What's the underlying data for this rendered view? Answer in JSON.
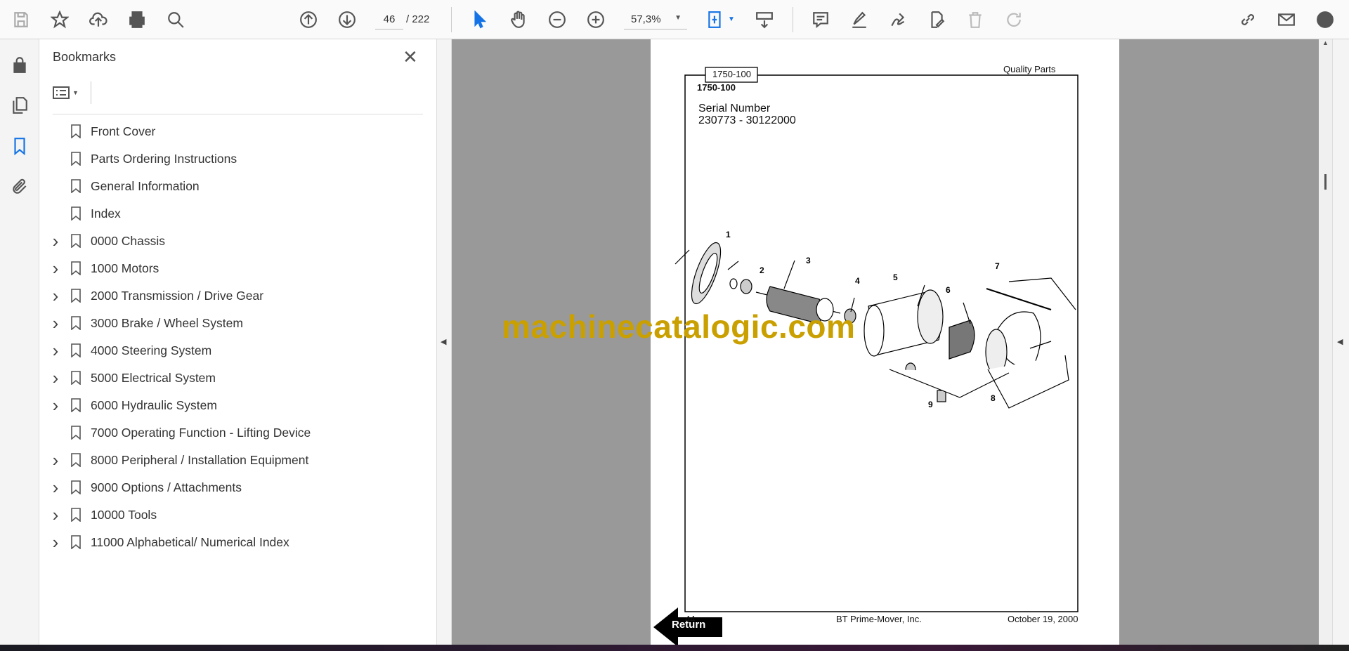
{
  "toolbar": {
    "page_current": "46",
    "page_total": "/ 222",
    "zoom": "57,3%",
    "icons": [
      "save-icon",
      "bookmark-star-icon",
      "upload-icon",
      "print-icon",
      "find-icon",
      "page-up-icon",
      "page-down-icon",
      "select-cursor-icon",
      "hand-icon",
      "zoom-out-icon",
      "zoom-in-icon",
      "fit-page-icon",
      "scroll-mode-icon",
      "comment-icon",
      "highlight-icon",
      "sign-icon",
      "edit-pdf-icon",
      "delete-icon",
      "rotate-icon",
      "share-link-icon",
      "email-icon",
      "account-icon"
    ]
  },
  "sidebar": {
    "title": "Bookmarks",
    "items": [
      {
        "label": "Front Cover",
        "expandable": false
      },
      {
        "label": "Parts Ordering Instructions",
        "expandable": false
      },
      {
        "label": "General Information",
        "expandable": false
      },
      {
        "label": "Index",
        "expandable": false
      },
      {
        "label": "0000 Chassis",
        "expandable": true
      },
      {
        "label": "1000 Motors",
        "expandable": true
      },
      {
        "label": "2000 Transmission / Drive Gear",
        "expandable": true
      },
      {
        "label": "3000 Brake / Wheel System",
        "expandable": true
      },
      {
        "label": "4000 Steering System",
        "expandable": true
      },
      {
        "label": "5000 Electrical System",
        "expandable": true
      },
      {
        "label": "6000 Hydraulic System",
        "expandable": true
      },
      {
        "label": "7000 Operating Function - Lifting Device",
        "expandable": false
      },
      {
        "label": "8000 Peripheral / Installation Equipment",
        "expandable": true
      },
      {
        "label": "9000 Options / Attachments",
        "expandable": true
      },
      {
        "label": "10000 Tools",
        "expandable": true
      },
      {
        "label": "11000 Alphabetical/ Numerical Index",
        "expandable": true
      }
    ]
  },
  "document": {
    "tab_label": "1750-100",
    "header_right": "Quality Parts",
    "section": "1750-100",
    "serial_label": "Serial Number",
    "serial_range": "230773 - 30122000",
    "callouts": [
      "1",
      "2",
      "3",
      "4",
      "5",
      "6",
      "7",
      "8",
      "9"
    ],
    "page_number": "44",
    "footer_center": "BT Prime-Mover, Inc.",
    "footer_date": "October 19, 2000",
    "return_label": "Return",
    "watermark": "machinecatalogic.com"
  },
  "colors": {
    "accent": "#1473e6",
    "watermark": "#c9a000",
    "viewer_bg": "#999999"
  }
}
